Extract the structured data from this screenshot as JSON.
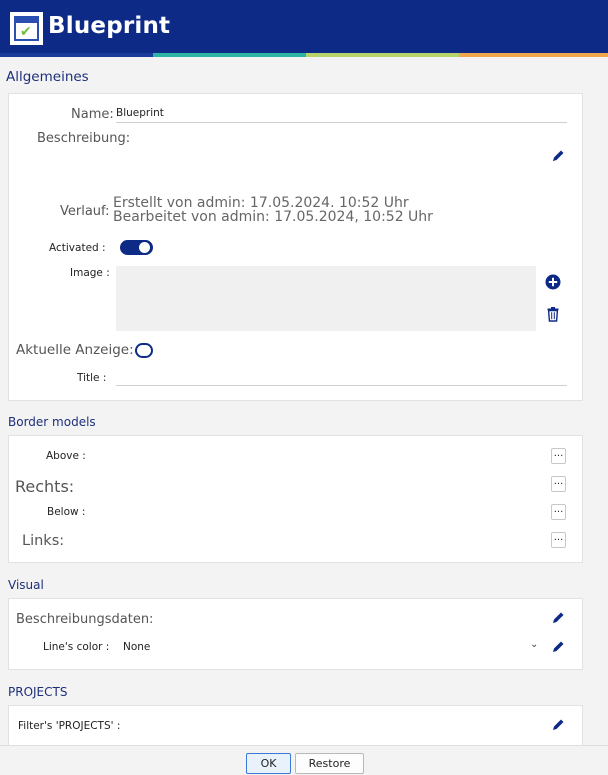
{
  "header": {
    "title": "Blueprint",
    "logo_icon": "blueprint-logo-icon"
  },
  "general": {
    "section_title": "Allgemeines",
    "name_label": "Name:",
    "name_value": "Blueprint",
    "description_label": "Beschreibung:",
    "history_label": "Verlauf:",
    "history_created": "Erstellt von admin: 17.05.2024. 10:52 Uhr",
    "history_edited": "Bearbeitet von admin: 17.05.2024, 10:52 Uhr",
    "activated_label": "Activated :",
    "activated": true,
    "image_label": "Image :",
    "current_display_label": "Aktuelle Anzeige:",
    "current_display": false,
    "title_label": "Title :"
  },
  "border_models": {
    "section_title": "Border models",
    "rows": [
      {
        "label": "Above :",
        "button": "..."
      },
      {
        "label": "Rechts:",
        "button": "..."
      },
      {
        "label": "Below :",
        "button": "..."
      },
      {
        "label": "Links:",
        "button": "..."
      }
    ]
  },
  "visual": {
    "section_title": "Visual",
    "description_data_label": "Beschreibungsdaten:",
    "line_color_label": "Line's color :",
    "line_color_value": "None"
  },
  "projects": {
    "section_title": "PROJECTS",
    "filter_label": "Filter's 'PROJECTS' :"
  },
  "footer": {
    "ok_label": "OK",
    "restore_label": "Restore"
  },
  "colors": {
    "brand": "#0e2a87",
    "accent_link": "#1e2f7a"
  }
}
